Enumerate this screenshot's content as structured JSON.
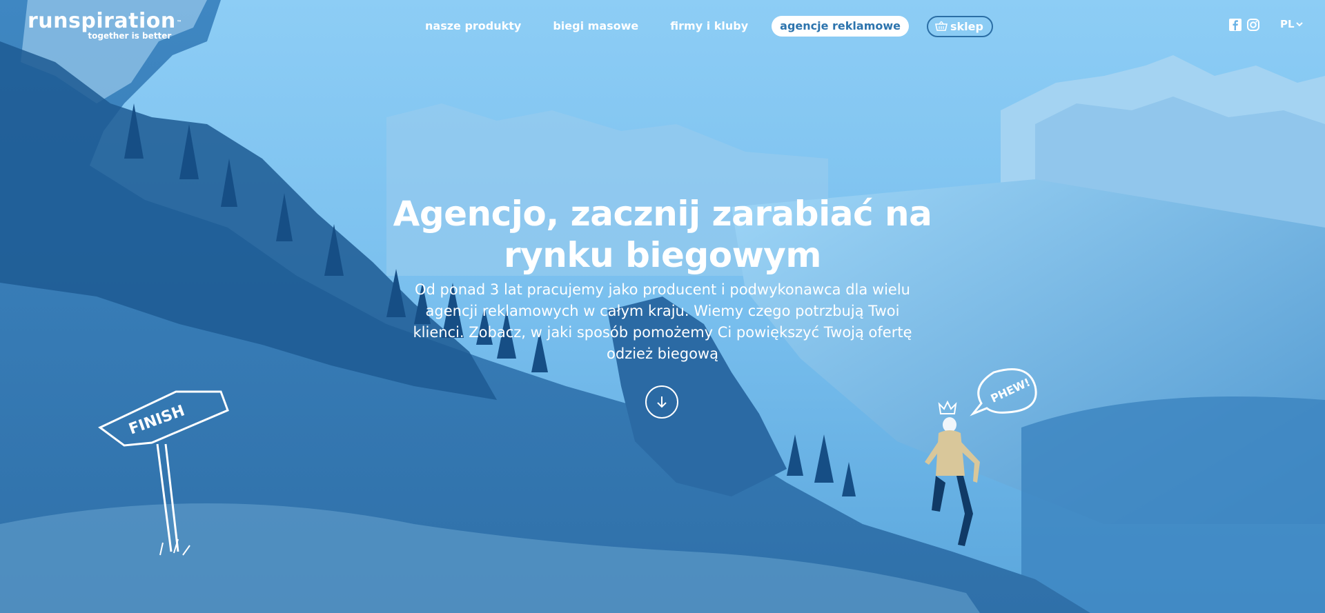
{
  "brand": {
    "name": "runspiration",
    "tm": "™",
    "tagline": "together is better"
  },
  "nav": {
    "items": [
      {
        "label": "nasze produkty"
      },
      {
        "label": "biegi masowe"
      },
      {
        "label": "firmy i kluby"
      },
      {
        "label": "agencje reklamowe",
        "active": true
      }
    ],
    "shop_label": "sklep"
  },
  "language": "PL",
  "social": [
    "facebook-icon",
    "instagram-icon"
  ],
  "hero": {
    "headline_line1": "Agencjo, zacznij zarabiać na",
    "headline_line2": "rynku biegowym",
    "subtext_line1": "Od ponad 3 lat pracujemy jako producent i podwykonawca dla wielu",
    "subtext_line2": "agencji reklamowych w całym kraju. Wiemy czego potrzbują Twoi",
    "subtext_line3": "klienci. Zobacz, w jaki sposób pomożemy Ci powiększyć Twoją ofertę",
    "subtext_line4": "odzież biegową",
    "sign_text": "FINISH",
    "bubble_text": "PHEW!"
  },
  "colors": {
    "accent": "#2d74ad",
    "overlay_light": "#7cc4f2",
    "overlay_dark": "#2a6aa6",
    "text": "#ffffff"
  }
}
